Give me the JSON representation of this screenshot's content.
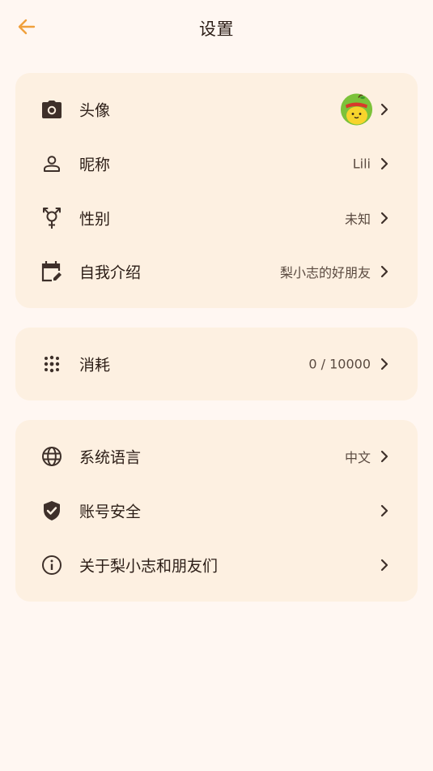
{
  "header": {
    "title": "设置",
    "back_icon": "arrow-left-icon",
    "accent_color": "#f0a03c"
  },
  "profile": {
    "avatar": {
      "label": "头像",
      "icon": "camera-icon"
    },
    "nickname": {
      "label": "昵称",
      "value": "Lili",
      "icon": "person-icon"
    },
    "gender": {
      "label": "性别",
      "value": "未知",
      "icon": "gender-icon"
    },
    "intro": {
      "label": "自我介绍",
      "value": "梨小志的好朋友",
      "icon": "calendar-edit-icon"
    }
  },
  "usage": {
    "label": "消耗",
    "value": "0 / 10000",
    "icon": "dots-grid-icon"
  },
  "system": {
    "language": {
      "label": "系统语言",
      "value": "中文",
      "icon": "globe-icon"
    },
    "security": {
      "label": "账号安全",
      "icon": "shield-check-icon"
    },
    "about": {
      "label": "关于梨小志和朋友们",
      "icon": "info-icon"
    }
  },
  "colors": {
    "background": "#fff7f2",
    "card": "#fdf0e1",
    "text": "#2b1d16",
    "secondary_text": "#5a4a40"
  }
}
